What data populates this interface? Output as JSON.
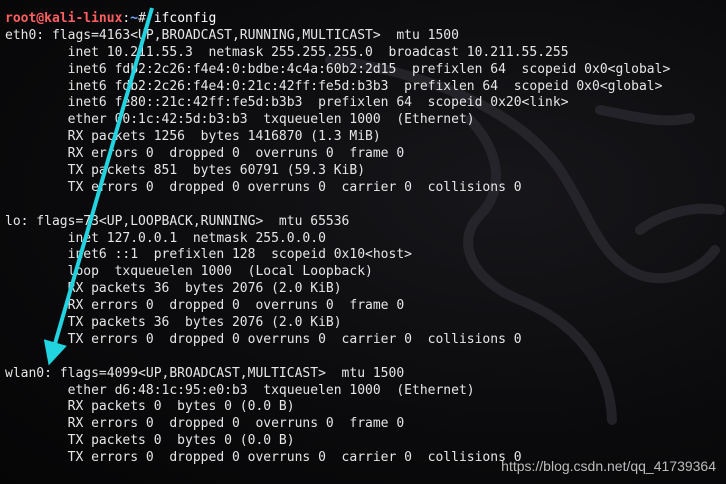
{
  "colors": {
    "prompt_user": "#ff5f5f",
    "prompt_path": "#6fa8ff",
    "output_text": "#e6e6e6",
    "arrow": "#22d3e0",
    "background": "#0b0b0d"
  },
  "terminal": {
    "prompt": {
      "user_host": "root@kali-linux",
      "separator": ":",
      "path": "~",
      "symbol": "#",
      "command": " ifconfig"
    },
    "lines": [
      "eth0: flags=4163<UP,BROADCAST,RUNNING,MULTICAST>  mtu 1500",
      "        inet 10.211.55.3  netmask 255.255.255.0  broadcast 10.211.55.255",
      "        inet6 fdb2:2c26:f4e4:0:bdbe:4c4a:60b2:2d15  prefixlen 64  scopeid 0x0<global>",
      "        inet6 fdb2:2c26:f4e4:0:21c:42ff:fe5d:b3b3  prefixlen 64  scopeid 0x0<global>",
      "        inet6 fe80::21c:42ff:fe5d:b3b3  prefixlen 64  scopeid 0x20<link>",
      "        ether 00:1c:42:5d:b3:b3  txqueuelen 1000  (Ethernet)",
      "        RX packets 1256  bytes 1416870 (1.3 MiB)",
      "        RX errors 0  dropped 0  overruns 0  frame 0",
      "        TX packets 851  bytes 60791 (59.3 KiB)",
      "        TX errors 0  dropped 0 overruns 0  carrier 0  collisions 0",
      "",
      "lo: flags=73<UP,LOOPBACK,RUNNING>  mtu 65536",
      "        inet 127.0.0.1  netmask 255.0.0.0",
      "        inet6 ::1  prefixlen 128  scopeid 0x10<host>",
      "        loop  txqueuelen 1000  (Local Loopback)",
      "        RX packets 36  bytes 2076 (2.0 KiB)",
      "        RX errors 0  dropped 0  overruns 0  frame 0",
      "        TX packets 36  bytes 2076 (2.0 KiB)",
      "        TX errors 0  dropped 0 overruns 0  carrier 0  collisions 0",
      "",
      "wlan0: flags=4099<UP,BROADCAST,MULTICAST>  mtu 1500",
      "        ether d6:48:1c:95:e0:b3  txqueuelen 1000  (Ethernet)",
      "        RX packets 0  bytes 0 (0.0 B)",
      "        RX errors 0  dropped 0  overruns 0  frame 0",
      "        TX packets 0  bytes 0 (0.0 B)",
      "        TX errors 0  dropped 0 overruns 0  carrier 0  collisions 0"
    ]
  },
  "watermark": "https://blog.csdn.net/qq_41739364"
}
